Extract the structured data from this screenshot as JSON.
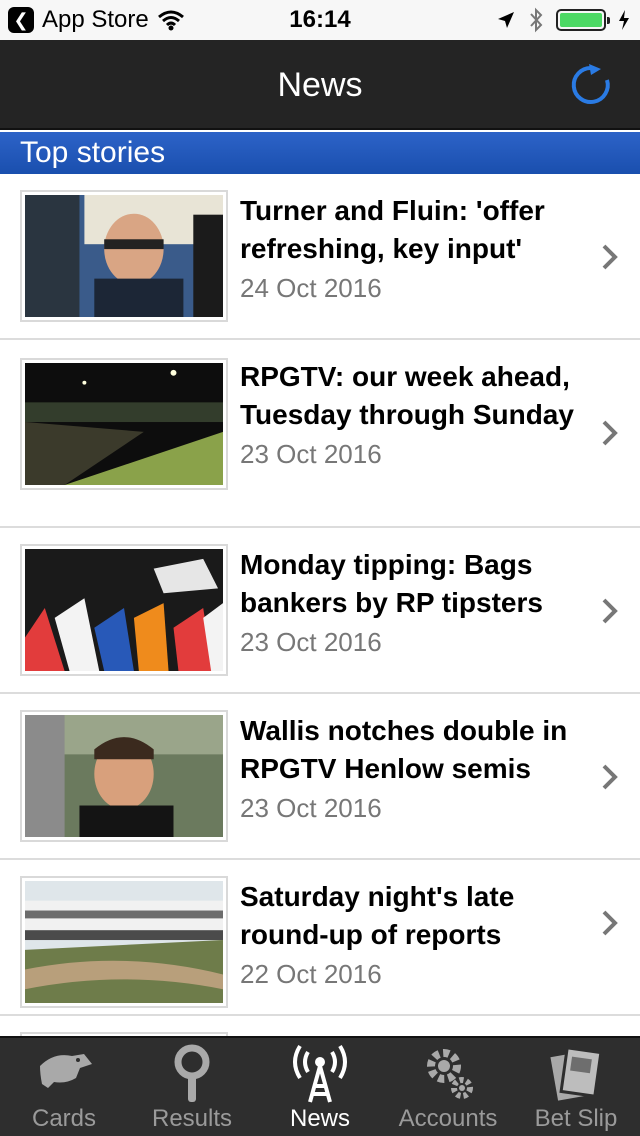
{
  "status_bar": {
    "back_app": "App Store",
    "time": "16:14"
  },
  "nav": {
    "title": "News"
  },
  "section": {
    "title": "Top stories"
  },
  "stories": [
    {
      "headline": "Turner and Fluin: 'offer refreshing, key input'",
      "date": "24 Oct 2016",
      "thumb": "man-glasses-interview"
    },
    {
      "headline": "RPGTV: our week ahead, Tuesday through Sunday",
      "date": "23 Oct 2016",
      "thumb": "night-track"
    },
    {
      "headline": "Monday tipping: Bags bankers by RP tipsters",
      "date": "23 Oct 2016",
      "thumb": "bags-bankers-logo"
    },
    {
      "headline": "Wallis notches double in RPGTV Henlow semis",
      "date": "23 Oct 2016",
      "thumb": "man-interview"
    },
    {
      "headline": "Saturday night's late round-up of reports",
      "date": "22 Oct 2016",
      "thumb": "stadium-track"
    }
  ],
  "tabs": [
    {
      "label": "Cards",
      "icon": "greyhound-icon"
    },
    {
      "label": "Results",
      "icon": "magnifier-icon"
    },
    {
      "label": "News",
      "icon": "broadcast-icon",
      "active": true
    },
    {
      "label": "Accounts",
      "icon": "gears-icon"
    },
    {
      "label": "Bet Slip",
      "icon": "betslip-icon"
    }
  ],
  "colors": {
    "nav_bg": "#242424",
    "section_bg": "#1f56b8",
    "accent_refresh": "#2a7be4",
    "tab_bg": "#2e2e2e"
  }
}
